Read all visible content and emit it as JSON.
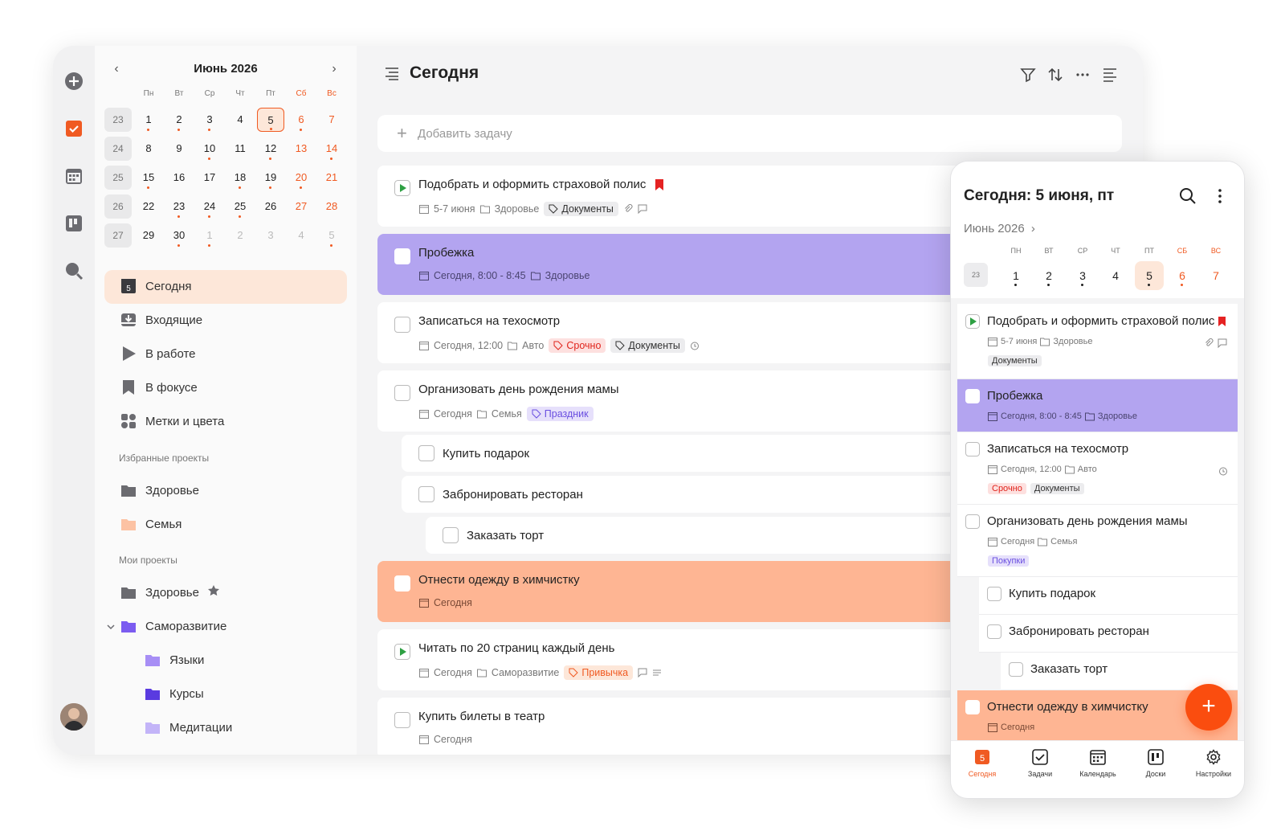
{
  "sidebar_calendar": {
    "month_title": "Июнь 2026",
    "weekdays": [
      "Пн",
      "Вт",
      "Ср",
      "Чт",
      "Пт",
      "Сб",
      "Вс"
    ],
    "weeks": [
      {
        "num": "23",
        "days": [
          "1",
          "2",
          "3",
          "4",
          "5",
          "6",
          "7"
        ]
      },
      {
        "num": "24",
        "days": [
          "8",
          "9",
          "10",
          "11",
          "12",
          "13",
          "14"
        ]
      },
      {
        "num": "25",
        "days": [
          "15",
          "16",
          "17",
          "18",
          "19",
          "20",
          "21"
        ]
      },
      {
        "num": "26",
        "days": [
          "22",
          "23",
          "24",
          "25",
          "26",
          "27",
          "28"
        ]
      },
      {
        "num": "27",
        "days": [
          "29",
          "30",
          "1",
          "2",
          "3",
          "4",
          "5"
        ]
      }
    ]
  },
  "nav": {
    "today_badge": "5",
    "items": [
      "Сегодня",
      "Входящие",
      "В работе",
      "В фокусе",
      "Метки и цвета"
    ],
    "favorites_title": "Избранные проекты",
    "favorites": [
      "Здоровье",
      "Семья"
    ],
    "my_projects_title": "Мои проекты",
    "projects": [
      "Здоровье",
      "Саморазвитие",
      "Языки",
      "Курсы",
      "Медитации"
    ]
  },
  "main": {
    "title": "Сегодня",
    "add_placeholder": "Добавить задачу",
    "tasks": [
      {
        "title": "Подобрать и оформить страховой полис",
        "date": "5-7 июня",
        "project": "Здоровье",
        "tag1": "Документы"
      },
      {
        "title": "Пробежка",
        "date": "Сегодня, 8:00 - 8:45",
        "project": "Здоровье"
      },
      {
        "title": "Записаться на техосмотр",
        "date": "Сегодня, 12:00",
        "project": "Авто",
        "tag1": "Срочно",
        "tag2": "Документы"
      },
      {
        "title": "Организовать день рождения мамы",
        "date": "Сегодня",
        "project": "Семья",
        "tag1": "Праздник"
      },
      {
        "title": "Купить подарок"
      },
      {
        "title": "Забронировать ресторан"
      },
      {
        "title": "Заказать торт"
      },
      {
        "title": "Отнести одежду в химчистку",
        "date": "Сегодня"
      },
      {
        "title": "Читать по 20 страниц каждый день",
        "date": "Сегодня",
        "project": "Саморазвитие",
        "tag1": "Привычка"
      },
      {
        "title": "Купить билеты в театр",
        "date": "Сегодня"
      }
    ]
  },
  "phone": {
    "title": "Сегодня: 5 июня, пт",
    "month": "Июнь 2026",
    "weekdays": [
      "ПН",
      "ВТ",
      "СР",
      "ЧТ",
      "ПТ",
      "СБ",
      "ВС"
    ],
    "week_num": "23",
    "days": [
      "1",
      "2",
      "3",
      "4",
      "5",
      "6",
      "7"
    ],
    "tasks": [
      {
        "title": "Подобрать и оформить страховой полис",
        "date": "5-7 июня",
        "project": "Здоровье",
        "tag1": "Документы"
      },
      {
        "title": "Пробежка",
        "date": "Сегодня, 8:00 - 8:45",
        "project": "Здоровье"
      },
      {
        "title": "Записаться на техосмотр",
        "date": "Сегодня, 12:00",
        "project": "Авто",
        "tag1": "Срочно",
        "tag2": "Документы"
      },
      {
        "title": "Организовать день рождения мамы",
        "date": "Сегодня",
        "project": "Семья",
        "tag1": "Покупки"
      },
      {
        "title": "Купить подарок"
      },
      {
        "title": "Забронировать ресторан"
      },
      {
        "title": "Заказать торт"
      },
      {
        "title": "Отнести одежду в химчистку",
        "date": "Сегодня"
      }
    ],
    "tabs": {
      "today_badge": "5",
      "today": "Сегодня",
      "tasks": "Задачи",
      "calendar": "Календарь",
      "boards": "Доски",
      "settings": "Настройки"
    },
    "fab": "+"
  },
  "colors": {
    "accent": "#f05a22",
    "purple": "#b3a4f0",
    "peach": "#feb593"
  }
}
